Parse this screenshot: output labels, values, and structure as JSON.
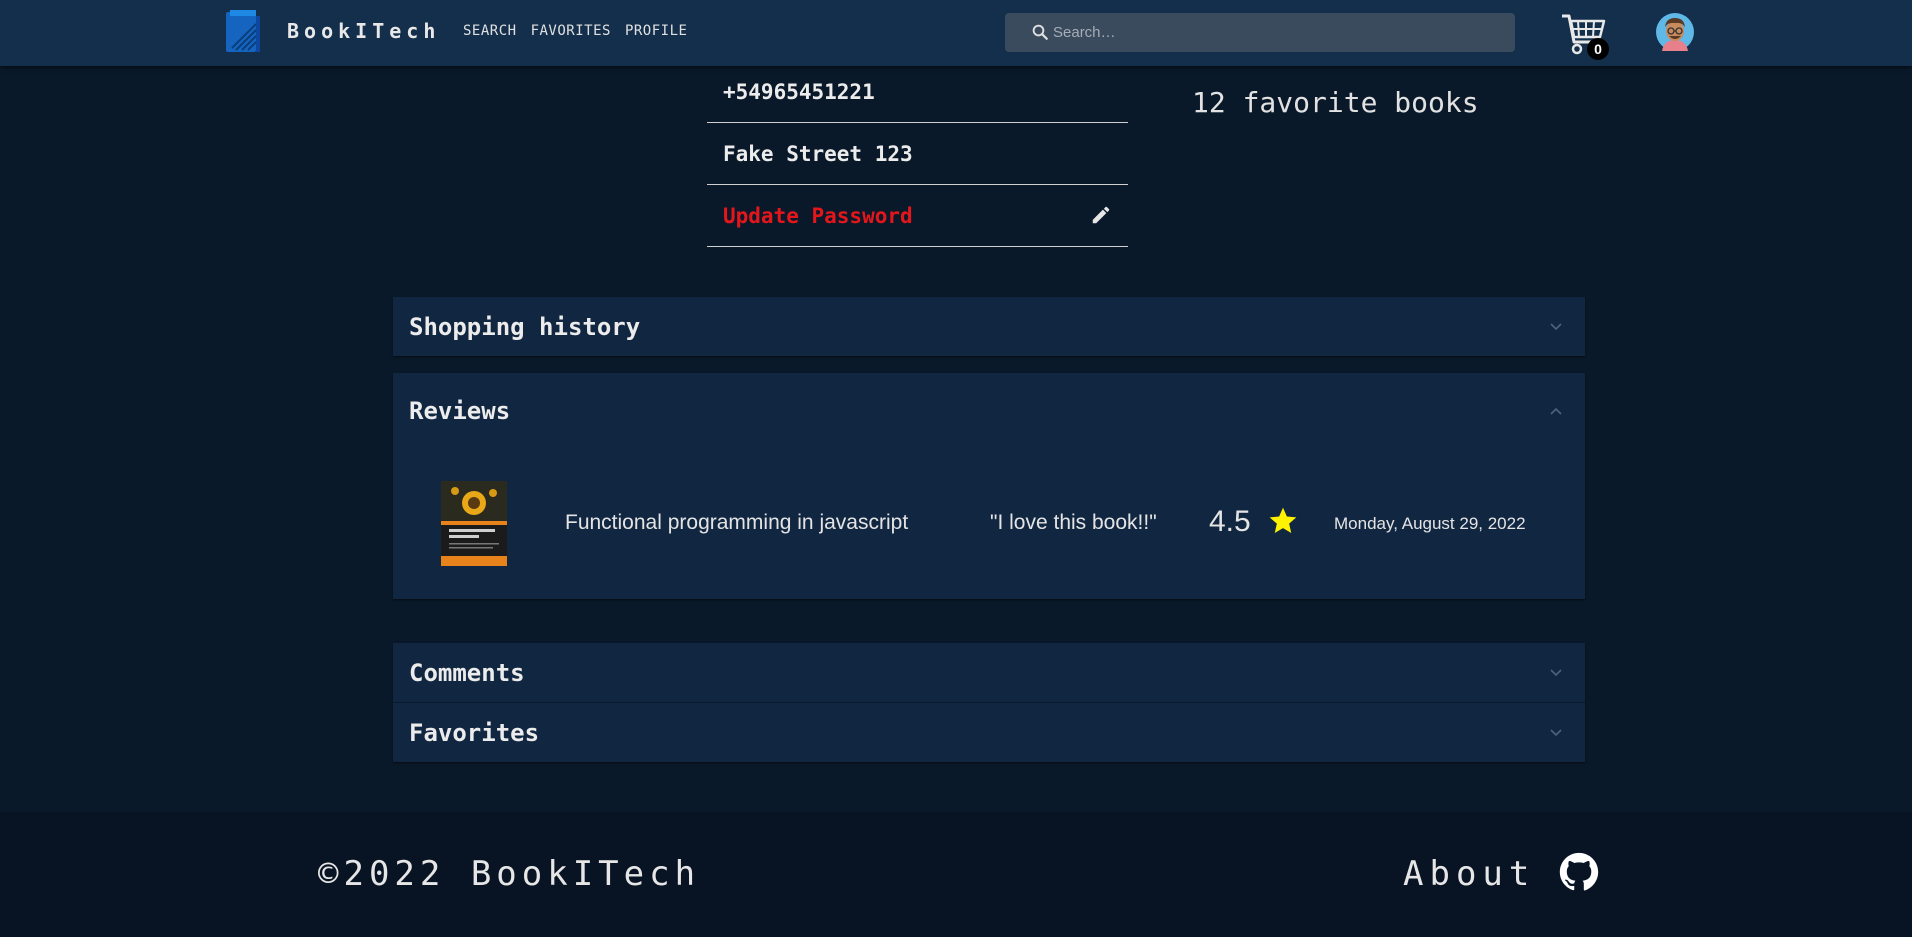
{
  "navbar": {
    "brand": "BookITech",
    "links": [
      "SEARCH",
      "FAVORITES",
      "PROFILE"
    ],
    "search_placeholder": "Search…",
    "cart_count": "0",
    "icons": [
      "logo-icon",
      "search-icon",
      "cart-icon",
      "avatar"
    ]
  },
  "profile": {
    "phone": "+54965451221",
    "address": "Fake Street 123",
    "update_password": "Update Password",
    "favorites_count": "12 favorite books"
  },
  "accordions": {
    "shopping_history": "Shopping history",
    "reviews": "Reviews",
    "comments": "Comments",
    "favorites": "Favorites"
  },
  "reviews": [
    {
      "book_title": "Functional programming in javascript",
      "review": "\"I love this book!!\"",
      "rating": "4.5",
      "date": "Monday, August 29, 2022"
    }
  ],
  "footer": {
    "copyright": "©2022 BookITech",
    "about": "About"
  },
  "colors": {
    "background": "#0a1929",
    "navbar": "#132f4c",
    "panel": "#112641",
    "accent_red": "#e5161b",
    "star": "#fff200"
  }
}
